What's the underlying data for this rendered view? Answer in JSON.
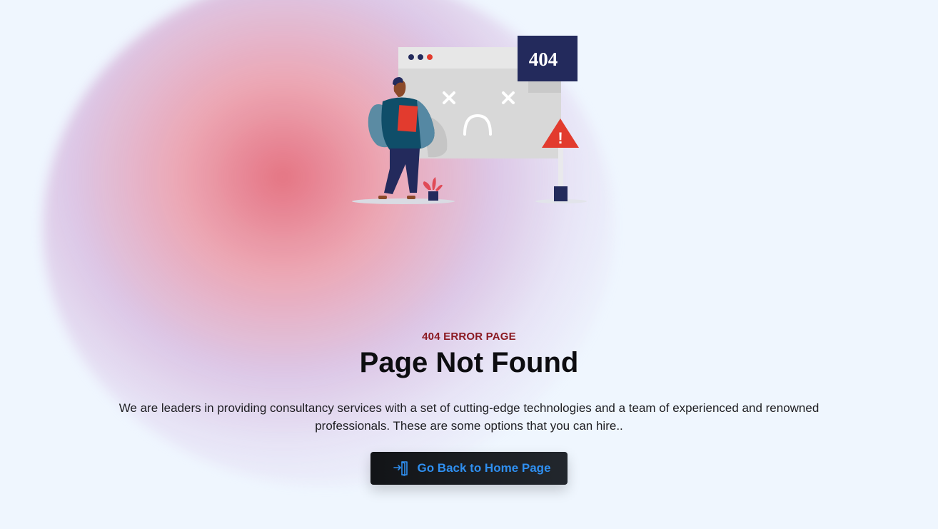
{
  "illustration": {
    "badge_text": "404",
    "warning_glyph": "!",
    "icons": [
      "browser-window-icon",
      "warning-sign-icon",
      "person-icon",
      "plant-icon"
    ]
  },
  "error": {
    "eyebrow": "404 ERROR PAGE",
    "title": "Page Not Found",
    "description": "We are leaders in providing consultancy services with a set of cutting-edge technologies and a team of experienced and renowned professionals. These are some options that you can hire.."
  },
  "cta": {
    "label": "Go Back to Home Page",
    "icon": "door-enter-icon"
  },
  "colors": {
    "eyebrow": "#8b1a22",
    "button_bg": "#16191d",
    "button_text": "#2f8ff0",
    "badge_bg": "#232a5c",
    "warning": "#e23b2e"
  }
}
